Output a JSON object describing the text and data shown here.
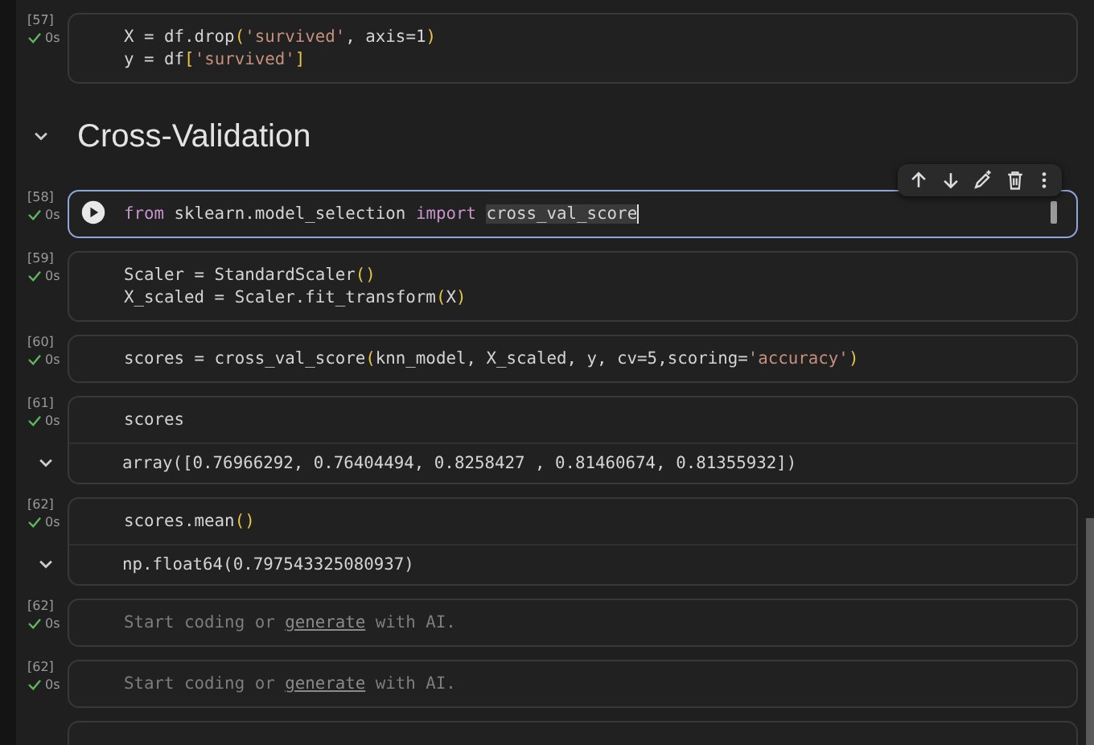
{
  "cells": [
    {
      "kind": "code",
      "number": "[57]",
      "status": "0s",
      "succeeded": true,
      "selected": false,
      "lines": [
        [
          {
            "kind": "plain",
            "text": "X = df.drop"
          },
          {
            "kind": "paren",
            "text": "("
          },
          {
            "kind": "string",
            "text": "'survived'"
          },
          {
            "kind": "plain",
            "text": ", axis=1"
          },
          {
            "kind": "paren",
            "text": ")"
          }
        ],
        [
          {
            "kind": "plain",
            "text": "y = df"
          },
          {
            "kind": "paren",
            "text": "["
          },
          {
            "kind": "string",
            "text": "'survived'"
          },
          {
            "kind": "paren",
            "text": "]"
          }
        ]
      ]
    },
    {
      "kind": "heading",
      "text": "Cross-Validation",
      "expanded": true
    },
    {
      "kind": "code",
      "number": "[58]",
      "status": "0s",
      "succeeded": true,
      "selected": true,
      "lines": [
        [
          {
            "kind": "keyword",
            "text": "from"
          },
          {
            "kind": "plain",
            "text": " sklearn.model_selection "
          },
          {
            "kind": "keyword",
            "text": "import "
          },
          {
            "kind": "match",
            "text": "cross_val_score"
          }
        ]
      ]
    },
    {
      "kind": "code",
      "number": "[59]",
      "status": "0s",
      "succeeded": true,
      "selected": false,
      "lines": [
        [
          {
            "kind": "plain",
            "text": "Scaler = StandardScaler"
          },
          {
            "kind": "paren",
            "text": "()"
          }
        ],
        [
          {
            "kind": "plain",
            "text": "X_scaled = Scaler.fit_transform"
          },
          {
            "kind": "paren",
            "text": "("
          },
          {
            "kind": "plain",
            "text": "X"
          },
          {
            "kind": "paren",
            "text": ")"
          }
        ]
      ]
    },
    {
      "kind": "code",
      "number": "[60]",
      "status": "0s",
      "succeeded": true,
      "selected": false,
      "lines": [
        [
          {
            "kind": "plain",
            "text": "scores = cross_val_score"
          },
          {
            "kind": "paren",
            "text": "("
          },
          {
            "kind": "plain",
            "text": "knn_model, X_scaled, y, cv=5,scoring="
          },
          {
            "kind": "string",
            "text": "'accuracy'"
          },
          {
            "kind": "paren",
            "text": ")"
          }
        ]
      ]
    },
    {
      "kind": "code",
      "number": "[61]",
      "status": "0s",
      "succeeded": true,
      "selected": false,
      "lines": [
        [
          {
            "kind": "plain",
            "text": "scores"
          }
        ]
      ],
      "output": {
        "text": "array([0.76966292, 0.76404494, 0.8258427 , 0.81460674, 0.81355932])",
        "expanded": true
      }
    },
    {
      "kind": "code",
      "number": "[62]",
      "status": "0s",
      "succeeded": true,
      "selected": false,
      "lines": [
        [
          {
            "kind": "plain",
            "text": "scores.mean"
          },
          {
            "kind": "paren",
            "text": "()"
          }
        ]
      ],
      "output": {
        "text": "np.float64(0.797543325080937)",
        "expanded": true
      }
    },
    {
      "kind": "empty",
      "number": "[62]",
      "status": "0s",
      "succeeded": true,
      "selected": false,
      "placeholder": "Start coding or",
      "link": "generate",
      "placeholder_end": "with AI."
    },
    {
      "kind": "empty",
      "number": "[62]",
      "status": "0s",
      "succeeded": true,
      "selected": false,
      "placeholder": "Start coding or",
      "link": "generate",
      "placeholder_end": "with AI."
    },
    {
      "kind": "partial"
    }
  ]
}
